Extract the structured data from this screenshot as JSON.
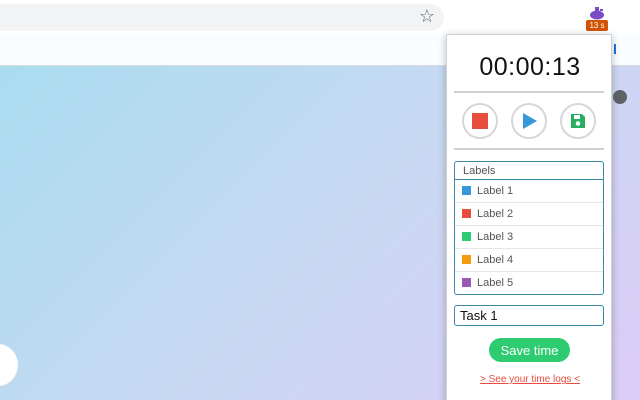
{
  "extension": {
    "badge": "13 s"
  },
  "popup": {
    "timer": "00:00:13",
    "labels_header": "Labels",
    "labels": [
      {
        "name": "Label 1",
        "color": "#3498db"
      },
      {
        "name": "Label 2",
        "color": "#e74c3c"
      },
      {
        "name": "Label 3",
        "color": "#2ecc71"
      },
      {
        "name": "Label 4",
        "color": "#f39c12"
      },
      {
        "name": "Label 5",
        "color": "#9b59b6"
      }
    ],
    "task_value": "Task 1",
    "save_label": "Save time",
    "logs_link": "> See your time logs <"
  },
  "icons": {
    "star": "star-icon",
    "stop": "stop-icon",
    "play": "play-icon",
    "save": "floppy-disk-icon"
  },
  "colors": {
    "stop": "#e74c3c",
    "play": "#3498db",
    "save": "#27ae60",
    "accent": "#2ecc71"
  }
}
